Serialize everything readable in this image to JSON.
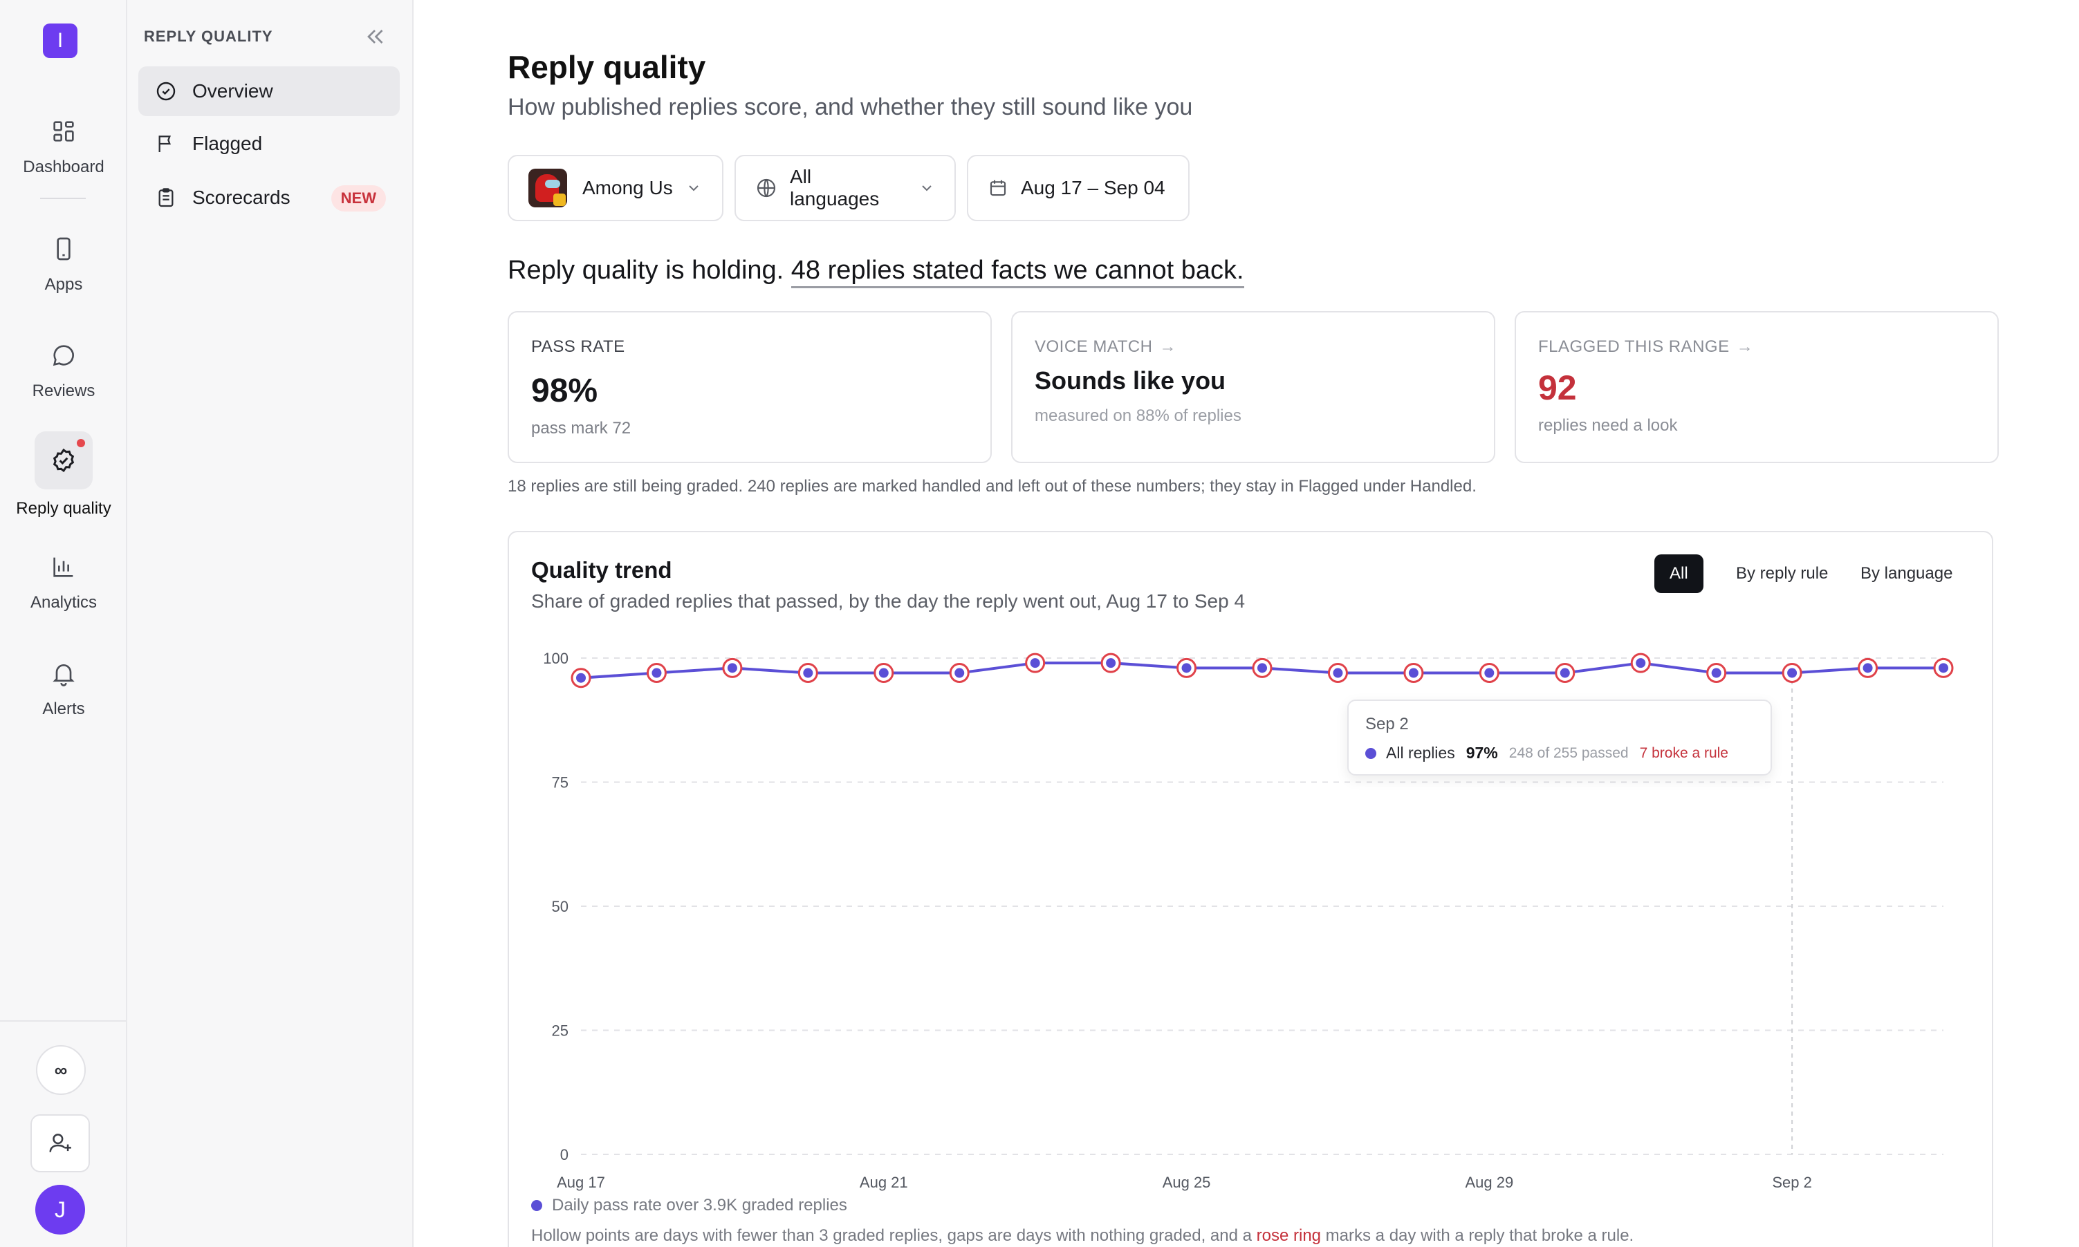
{
  "rail": {
    "logo_letter": "I",
    "items": [
      {
        "label": "Dashboard",
        "icon": "grid-icon"
      },
      {
        "label": "Apps",
        "icon": "phone-icon"
      },
      {
        "label": "Reviews",
        "icon": "chat-bubble-icon"
      },
      {
        "label": "Reply quality",
        "icon": "check-badge-icon",
        "active": true,
        "has_dot": true
      },
      {
        "label": "Analytics",
        "icon": "bar-chart-icon"
      },
      {
        "label": "Alerts",
        "icon": "bell-icon"
      }
    ],
    "infinity_label": "∞",
    "avatar_letter": "J"
  },
  "subnav": {
    "title": "REPLY QUALITY",
    "items": [
      {
        "label": "Overview",
        "icon": "check-circle-icon",
        "active": true
      },
      {
        "label": "Flagged",
        "icon": "flag-icon"
      },
      {
        "label": "Scorecards",
        "icon": "clipboard-icon",
        "badge": "NEW"
      }
    ]
  },
  "page": {
    "title": "Reply quality",
    "subtitle": "How published replies score, and whether they still sound like you"
  },
  "filters": {
    "app": "Among Us",
    "language": "All languages",
    "date_range": "Aug 17 – Sep 04"
  },
  "headline": {
    "lead": "Reply quality is holding.",
    "link": "48 replies stated facts we cannot back."
  },
  "cards": {
    "pass_rate": {
      "label": "PASS RATE",
      "value": "98%",
      "sub": "pass mark 72"
    },
    "voice_match": {
      "label": "VOICE MATCH",
      "value": "Sounds like you",
      "sub": "measured on 88% of replies"
    },
    "flagged": {
      "label": "FLAGGED THIS RANGE",
      "value": "92",
      "sub": "replies need a look"
    }
  },
  "note": "18 replies are still being graded. 240 replies are marked handled and left out of these numbers; they stay in Flagged under Handled.",
  "trend": {
    "title": "Quality trend",
    "subtitle": "Share of graded replies that passed, by the day the reply went out, Aug 17 to Sep 4",
    "segments": [
      "All",
      "By reply rule",
      "By language"
    ],
    "active_segment": "All",
    "tooltip": {
      "date": "Sep 2",
      "series": "All replies",
      "value": "97%",
      "detail": "248 of 255 passed",
      "broke": "7 broke a rule"
    },
    "legend": "Daily pass rate over 3.9K graded replies",
    "footnote_pre": "Hollow points are days with fewer than 3 graded replies, gaps are days with nothing graded, and a ",
    "footnote_rose": "rose ring",
    "footnote_post": " marks a day with a reply that broke a rule."
  },
  "colors": {
    "accent": "#6d3cf0",
    "line": "#5b4fd6",
    "rose": "#e0424a",
    "flagged_value": "#c4313b"
  },
  "chart_data": {
    "type": "line",
    "x": [
      "Aug 17",
      "Aug 18",
      "Aug 19",
      "Aug 20",
      "Aug 21",
      "Aug 22",
      "Aug 23",
      "Aug 24",
      "Aug 25",
      "Aug 26",
      "Aug 27",
      "Aug 28",
      "Aug 29",
      "Aug 30",
      "Aug 31",
      "Sep 1",
      "Sep 2",
      "Sep 3",
      "Sep 4"
    ],
    "series": [
      {
        "name": "All replies",
        "values": [
          96,
          97,
          98,
          97,
          97,
          97,
          99,
          99,
          98,
          98,
          97,
          97,
          97,
          97,
          99,
          97,
          97,
          98,
          98
        ]
      }
    ],
    "rose_ring": [
      true,
      true,
      true,
      true,
      true,
      true,
      true,
      true,
      true,
      true,
      true,
      true,
      true,
      true,
      true,
      true,
      true,
      true,
      true
    ],
    "x_ticks": [
      "Aug 17",
      "Aug 21",
      "Aug 25",
      "Aug 29",
      "Sep 2"
    ],
    "y_ticks": [
      0,
      25,
      50,
      75,
      100
    ],
    "ylim": [
      0,
      100
    ],
    "highlight": "Sep 2",
    "grid": true
  }
}
